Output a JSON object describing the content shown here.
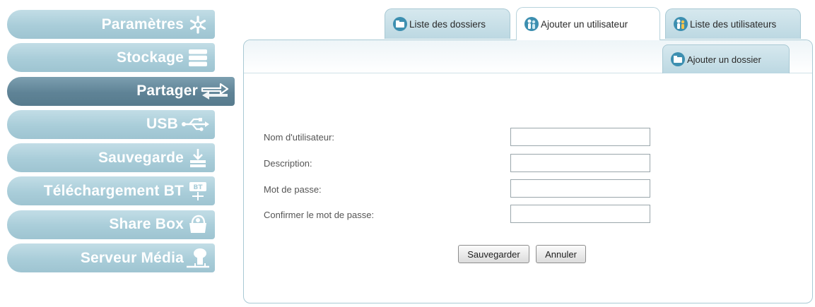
{
  "sidebar": {
    "items": [
      {
        "label": "Paramètres",
        "icon": "gear-icon",
        "active": false
      },
      {
        "label": "Stockage",
        "icon": "storage-icon",
        "active": false
      },
      {
        "label": "Partager",
        "icon": "share-arrows-icon",
        "active": true
      },
      {
        "label": "USB",
        "icon": "usb-icon",
        "active": false
      },
      {
        "label": "Sauvegarde",
        "icon": "backup-icon",
        "active": false
      },
      {
        "label": "Téléchargement BT",
        "icon": "bittorrent-icon",
        "active": false
      },
      {
        "label": "Share Box",
        "icon": "share-box-icon",
        "active": false
      },
      {
        "label": "Serveur Média",
        "icon": "media-server-icon",
        "active": false
      }
    ]
  },
  "tabs": [
    {
      "label": "Liste des dossiers",
      "icon": "folder-list-icon",
      "active": false
    },
    {
      "label": "Ajouter un utilisateur",
      "icon": "add-user-icon",
      "active": true
    },
    {
      "label": "Liste des utilisateurs",
      "icon": "user-list-icon",
      "active": false
    }
  ],
  "subtab": {
    "label": "Ajouter un dossier",
    "icon": "add-folder-icon"
  },
  "form": {
    "username_label": "Nom d'utilisateur:",
    "username_value": "",
    "description_label": "Description:",
    "description_value": "",
    "password_label": "Mot de passe:",
    "password_value": "",
    "confirm_label": "Confirmer le mot de passe:",
    "confirm_value": ""
  },
  "buttons": {
    "save": "Sauvegarder",
    "cancel": "Annuler"
  },
  "colors": {
    "sidebar_item": "#a9cdd9",
    "sidebar_active": "#5f8396",
    "tab": "#bcd8e2",
    "panel_border": "#a9c9d4"
  }
}
